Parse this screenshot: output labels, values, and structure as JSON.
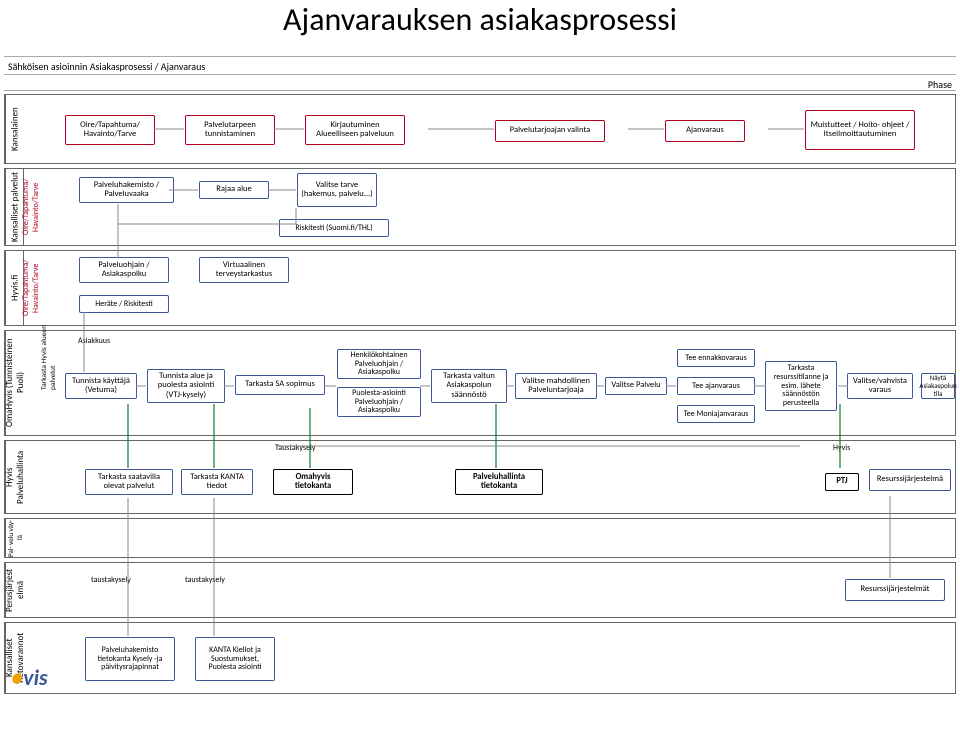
{
  "title": "Ajanvarauksen asiakasprosessi",
  "breadcrumb": "Sähköisen asioinnin Asiakasprosessi / Ajanvaraus",
  "phase_label": "Phase",
  "lanes": {
    "kansalainen": {
      "label": "Kansalainen"
    },
    "kansalliset_palvelut": {
      "label": "Kansalliset\npalvelut",
      "sublabel": "Oire/Tapahtuma/\nHavainto/Tarve"
    },
    "hyvis_fi": {
      "label": "Hyvis.fi",
      "sublabel": "Oire/Tapahtuma/\nHavainto/Tarve"
    },
    "omahyvis": {
      "label": "OmaHyvis\n(Tunnisteinen Puoli)"
    },
    "hyvis_palveluhallinta": {
      "label": "Hyvis\nPalveluhallinta"
    },
    "palveluvayla": {
      "label": "Pal-\nvelu\n väy-\nlä"
    },
    "perusjarjestelma": {
      "label": "Perusjärjest\nelmä"
    },
    "kansalliset_tietovarannot": {
      "label": "Kansalliset\nTietovarannot"
    }
  },
  "side_notes": {
    "asiakkuus": "Asiakkuus",
    "tarkasta_hyvis_alueen": "Tarkasta Hyvis alueen palvelut"
  },
  "boxes": {
    "k_oire": "Oire/Tapahtuma/\nHavainto/Tarve",
    "k_tarpeen": "Palvelutarpeen\ntunnistaminen",
    "k_kirj": "Kirjautuminen\nAlueelliseen palveluun",
    "k_tarj": "Palvelutarjoajan valinta",
    "k_ajan": "Ajanvaraus",
    "k_muist": "Muistutteet / Hoito-\nohjeet /\nItseilmoittautuminen",
    "kp_hake": "Palveluhakemisto /\nPalveluvaaka",
    "kp_rajaa": "Rajaa alue",
    "kp_valitse": "Valitse tarve\n(hakemus,\npalvelu...)",
    "kp_riski": "Riskitesti (Suomi.fi/THL)",
    "hf_polku": "Palveluohjain /\nAsiakaspolku",
    "hf_virt": "Virtuaalinen\nterveystarkastus",
    "hf_herate": "Heräte / Riskitesti",
    "oh_vetuma": "Tunnista käyttäjä\n(Vetuma)",
    "oh_alue": "Tunnista alue ja\npuolesta asiointi\n(VTJ-kysely)",
    "oh_sa": "Tarkasta SA sopimus",
    "oh_henk": "Henkilökohtainen\nPalveluohjain /\nAsiakaspolku",
    "oh_puol": "Puolesta-asiointi\nPalveluohjain /\nAsiakaspolku",
    "oh_valtun": "Tarkasta valtun\nAsiakaspolun\nsäännöstö",
    "oh_mahd": "Valitse mahdollinen\nPalveluntarjoaja",
    "oh_valp": "Valitse Palvelu",
    "oh_ennakko": "Tee ennakkovaraus",
    "oh_ajan": "Tee ajanvaraus",
    "oh_monia": "Tee Moniajanvaraus",
    "oh_res": "Tarkasta\nresurssitilanne ja\nesim. lähete\nsäännöstön\nperusteella",
    "oh_vahv": "Valitse/vahvista\nvaraus",
    "oh_tila": "Näytä Asiakaspolun\ntila",
    "hp_saat": "Tarkasta saatavilla\nolevat palvelut",
    "hp_kanta": "Tarkasta KANTA\ntiedot",
    "hp_oma": "Omahyvis\ntietokanta",
    "hp_pal": "Palveluhallinta\ntietokanta",
    "hp_ptj": "PTJ",
    "hp_resj": "Resurssijärjestelmä",
    "pj_t1": "taustakysely",
    "pj_t2": "taustakysely",
    "pj_res": "Resurssijärjestelmät",
    "kt_hake": "Palveluhakemisto\ntietokanta\nKysely -ja\npäivitysrajapinnat",
    "kt_kanta": "KANTA\nKiellot ja\nSuostumukset,\nPuolesta asiointi"
  },
  "free_labels": {
    "taustakysely_top": "Taustakysely",
    "hyvis_right": "Hyvis"
  },
  "logo": {
    "text": "vis",
    "prefix_glyph": "●"
  }
}
